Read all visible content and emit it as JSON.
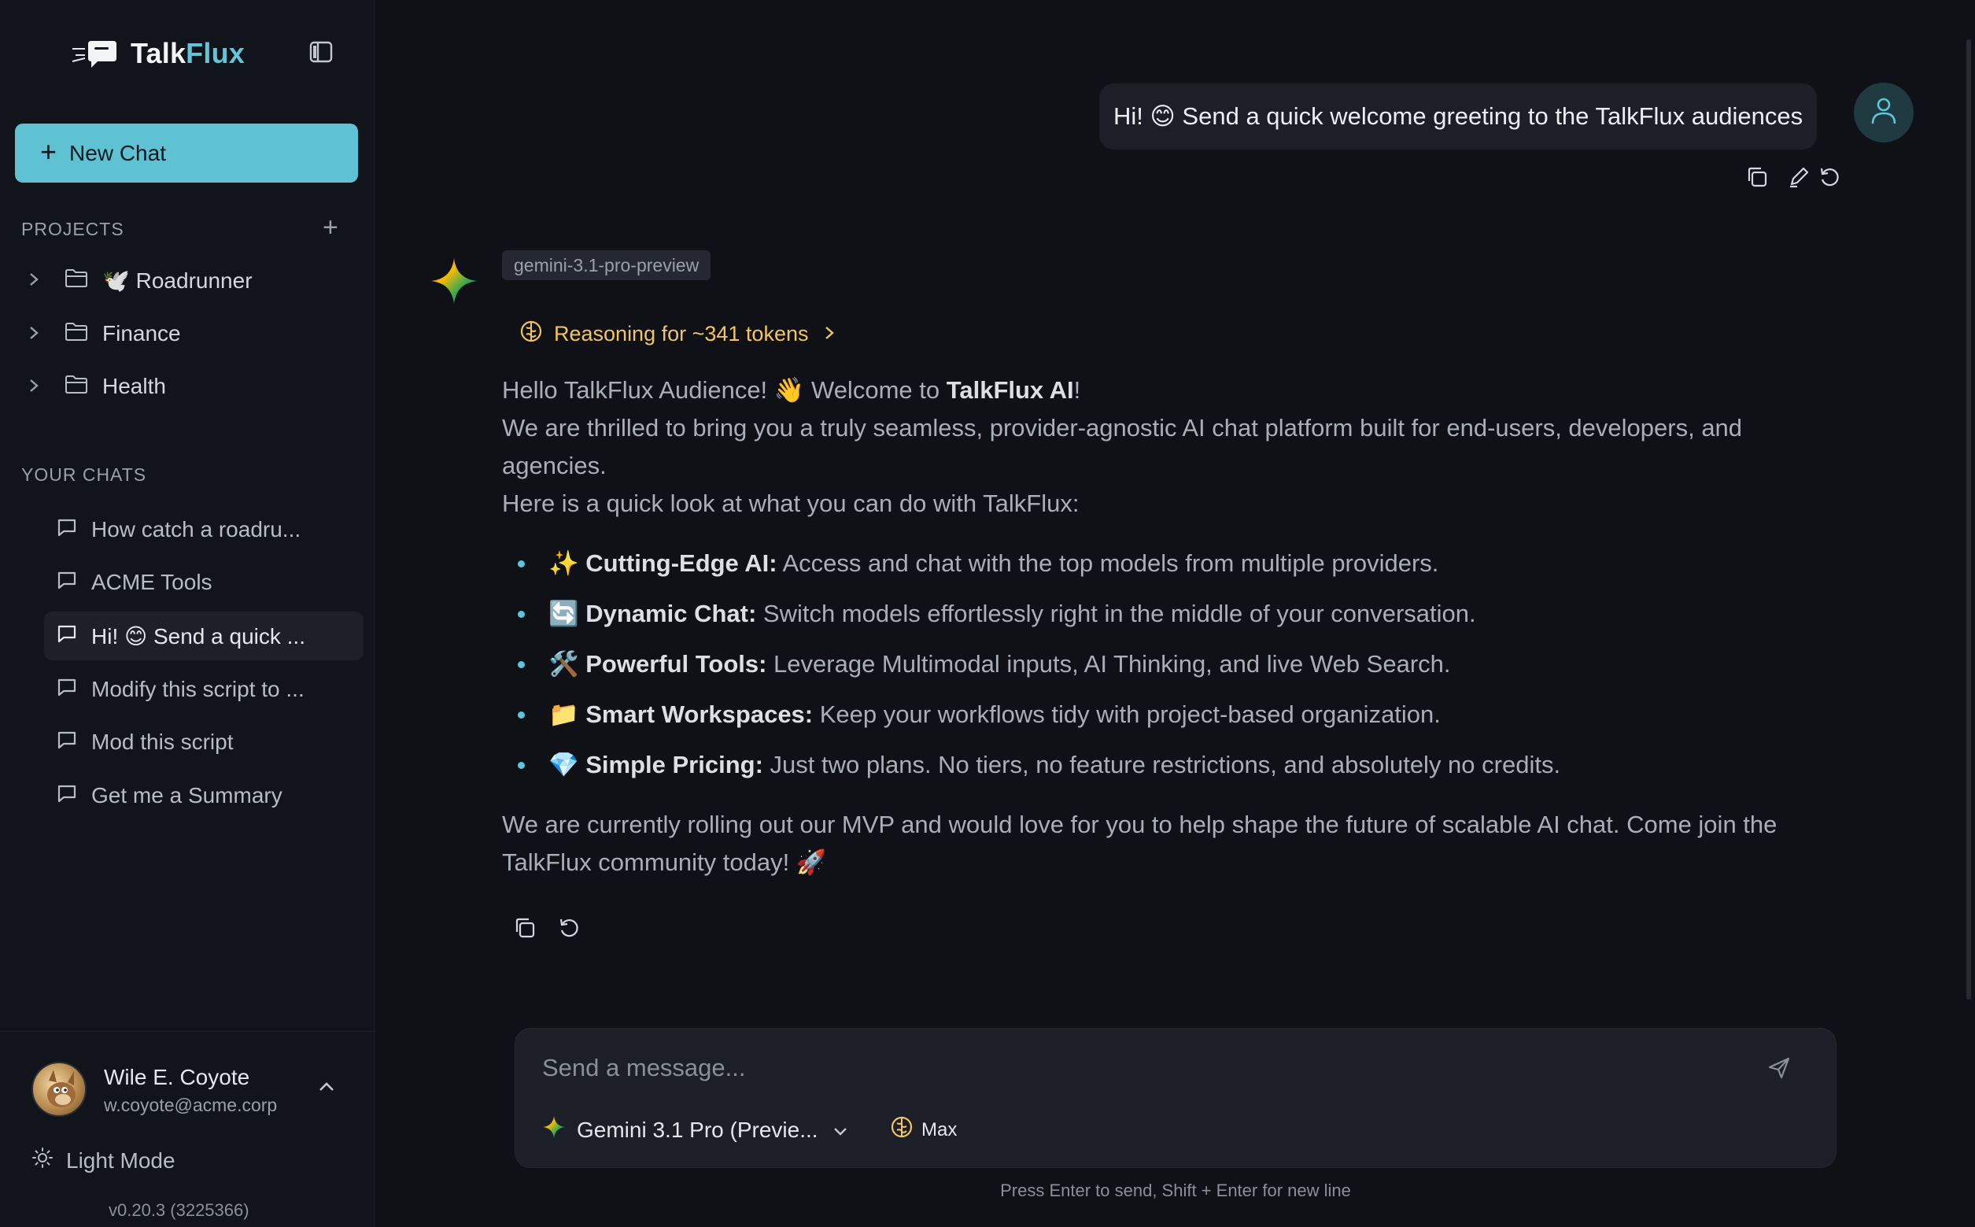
{
  "app": {
    "brand_prefix": "Talk",
    "brand_accent": "Flux",
    "accent_color": "#5ec6d8"
  },
  "sidebar": {
    "new_chat_label": "New Chat",
    "projects_title": "PROJECTS",
    "projects": [
      {
        "label": "🕊️ Roadrunner"
      },
      {
        "label": "Finance"
      },
      {
        "label": "Health"
      }
    ],
    "chats_title": "YOUR CHATS",
    "chats": [
      {
        "label": "How catch a roadru...",
        "active": false
      },
      {
        "label": "ACME Tools",
        "active": false
      },
      {
        "label": "Hi! 😊 Send a quick ...",
        "active": true
      },
      {
        "label": "Modify this script to ...",
        "active": false
      },
      {
        "label": "Mod this script",
        "active": false
      },
      {
        "label": "Get me a Summary",
        "active": false
      }
    ],
    "user": {
      "name": "Wile E. Coyote",
      "email": "w.coyote@acme.corp"
    },
    "theme_toggle_label": "Light Mode",
    "version": "v0.20.3 (3225366)"
  },
  "conversation": {
    "user_message": "Hi! 😊 Send a quick welcome greeting to the TalkFlux audiences",
    "model_tag": "gemini-3.1-pro-preview",
    "reasoning_label": "Reasoning for ~341 tokens",
    "reply": {
      "greeting_pre": "Hello TalkFlux Audience! 👋 Welcome to ",
      "greeting_bold": "TalkFlux AI",
      "greeting_post": "!",
      "intro": "We are thrilled to bring you a truly seamless, provider-agnostic AI chat platform built for end-users, developers, and agencies.",
      "lead": "Here is a quick look at what you can do with TalkFlux:",
      "bullets": [
        {
          "emoji": "✨",
          "title": "Cutting-Edge AI:",
          "text": " Access and chat with the top models from multiple providers."
        },
        {
          "emoji": "🔄",
          "title": "Dynamic Chat:",
          "text": " Switch models effortlessly right in the middle of your conversation."
        },
        {
          "emoji": "🛠️",
          "title": "Powerful Tools:",
          "text": " Leverage Multimodal inputs, AI Thinking, and live Web Search."
        },
        {
          "emoji": "📁",
          "title": "Smart Workspaces:",
          "text": " Keep your workflows tidy with project-based organization."
        },
        {
          "emoji": "💎",
          "title": "Simple Pricing:",
          "text": " Just two plans. No tiers, no feature restrictions, and absolutely no credits."
        }
      ],
      "closing": "We are currently rolling out our MVP and would love for you to help shape the future of scalable AI chat. Come join the TalkFlux community today! 🚀"
    }
  },
  "composer": {
    "placeholder": "Send a message...",
    "model_label": "Gemini 3.1 Pro (Previe...",
    "effort_label": "Max",
    "hint": "Press Enter to send, Shift + Enter for new line"
  }
}
